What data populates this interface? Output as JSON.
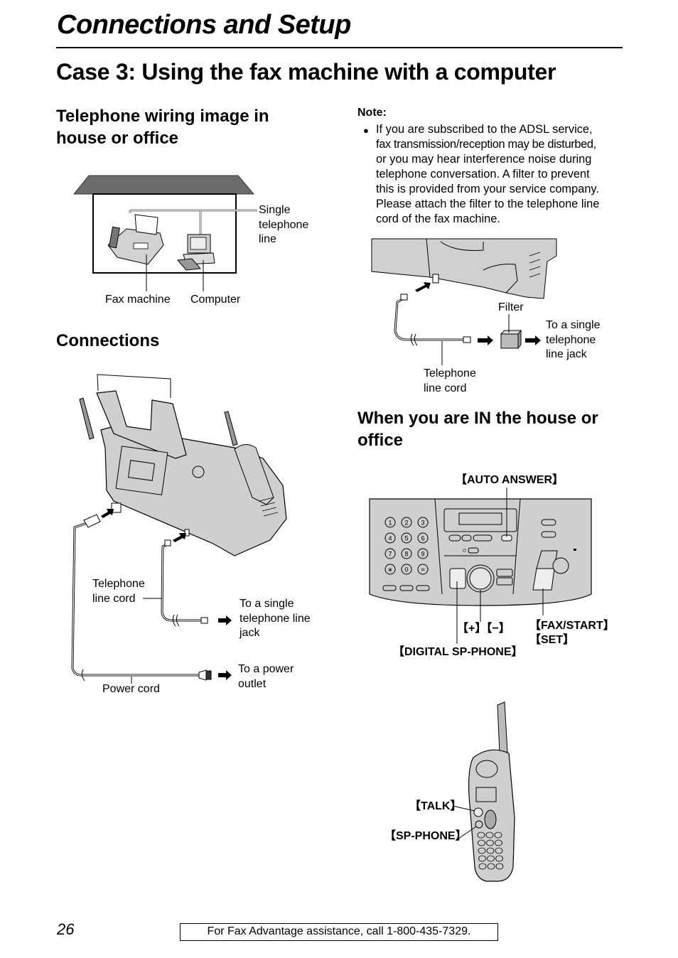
{
  "header": {
    "section_title": "Connections and Setup",
    "page_title": "Case 3: Using the fax machine with a computer"
  },
  "wiring": {
    "heading_line1": "Telephone wiring image in",
    "heading_line2": "house or office",
    "labels": {
      "single_line": [
        "Single",
        "telephone",
        "line"
      ],
      "fax_machine": "Fax machine",
      "computer": "Computer"
    }
  },
  "note": {
    "heading": "Note:",
    "bullet_icon": "bullet-dot",
    "lines": [
      "If you are subscribed to the ADSL service,",
      "fax transmission/reception may be disturbed,",
      "or you may hear interference noise during",
      "telephone conversation. A filter to prevent",
      "this is provided from your service company.",
      "Please attach the filter to the telephone line",
      "cord of the fax machine."
    ]
  },
  "filter_diagram": {
    "filter_label": "Filter",
    "jack_label": [
      "To a single",
      "telephone",
      "line jack"
    ],
    "cord_label": [
      "Telephone",
      "line cord"
    ]
  },
  "connections": {
    "heading": "Connections",
    "labels": {
      "phone_cord": [
        "Telephone",
        "line cord"
      ],
      "phone_jack": [
        "To a single",
        "telephone line",
        "jack"
      ],
      "power_outlet": [
        "To a power",
        "outlet"
      ],
      "power_cord": "Power cord"
    }
  },
  "in_house": {
    "heading_line1": "When you are IN the house or",
    "heading_line2": "office",
    "panel_labels": {
      "auto_answer": "【AUTO ANSWER】",
      "plus_minus": "【+】【−】",
      "digital_sp_phone": "【DIGITAL SP-PHONE】",
      "fax_start": "【FAX/START】",
      "set": "【SET】"
    },
    "keypad": [
      "1",
      "2",
      "3",
      "4",
      "5",
      "6",
      "7",
      "8",
      "9",
      "∗",
      "0",
      "⌗"
    ],
    "handset_labels": {
      "talk": "【TALK】",
      "sp_phone": "【SP-PHONE】"
    }
  },
  "footer": {
    "page_number": "26",
    "assistance": "For Fax Advantage assistance, call 1-800-435-7329."
  }
}
